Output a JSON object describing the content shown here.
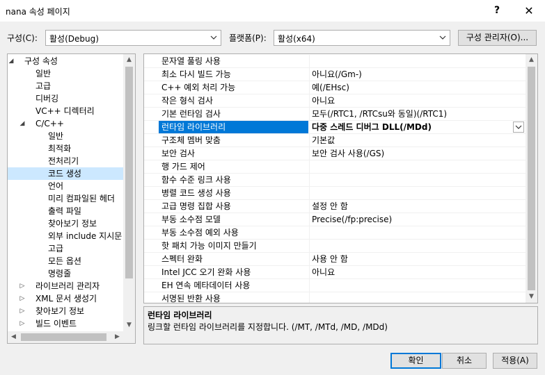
{
  "window": {
    "title": "nana 속성 페이지",
    "help": "?",
    "close": "✕"
  },
  "config": {
    "label": "구성(C):",
    "value": "활성(Debug)"
  },
  "platform": {
    "label": "플랫폼(P):",
    "value": "활성(x64)"
  },
  "config_manager_label": "구성 관리자(O)...",
  "tree": [
    {
      "label": "구성 속성",
      "level": 0,
      "expander": "◢"
    },
    {
      "label": "일반",
      "level": 1
    },
    {
      "label": "고급",
      "level": 1
    },
    {
      "label": "디버깅",
      "level": 1
    },
    {
      "label": "VC++ 디렉터리",
      "level": 1
    },
    {
      "label": "C/C++",
      "level": 1,
      "expander": "◢"
    },
    {
      "label": "일반",
      "level": 2
    },
    {
      "label": "최적화",
      "level": 2
    },
    {
      "label": "전처리기",
      "level": 2
    },
    {
      "label": "코드 생성",
      "level": 2,
      "selected": true
    },
    {
      "label": "언어",
      "level": 2
    },
    {
      "label": "미리 컴파일된 헤더",
      "level": 2
    },
    {
      "label": "출력 파일",
      "level": 2
    },
    {
      "label": "찾아보기 정보",
      "level": 2
    },
    {
      "label": "외부 include 지시문",
      "level": 2
    },
    {
      "label": "고급",
      "level": 2
    },
    {
      "label": "모든 옵션",
      "level": 2
    },
    {
      "label": "명령줄",
      "level": 2
    },
    {
      "label": "라이브러리 관리자",
      "level": 1,
      "expander": "▷"
    },
    {
      "label": "XML 문서 생성기",
      "level": 1,
      "expander": "▷"
    },
    {
      "label": "찾아보기 정보",
      "level": 1,
      "expander": "▷"
    },
    {
      "label": "빌드 이벤트",
      "level": 1,
      "expander": "▷"
    }
  ],
  "properties": [
    {
      "name": "문자열 풀링 사용",
      "value": ""
    },
    {
      "name": "최소 다시 빌드 가능",
      "value": "아니요(/Gm-)"
    },
    {
      "name": "C++ 예외 처리 가능",
      "value": "예(/EHsc)"
    },
    {
      "name": "작은 형식 검사",
      "value": "아니요"
    },
    {
      "name": "기본 런타임 검사",
      "value": "모두(/RTC1, /RTCsu와 동일)(/RTC1)"
    },
    {
      "name": "런타임 라이브러리",
      "value": "다중 스레드 디버그 DLL(/MDd)",
      "selected": true
    },
    {
      "name": "구조체 멤버 맞춤",
      "value": "기본값"
    },
    {
      "name": "보안 검사",
      "value": "보안 검사 사용(/GS)"
    },
    {
      "name": "행 가드 제어",
      "value": ""
    },
    {
      "name": "함수 수준 링크 사용",
      "value": ""
    },
    {
      "name": "병렬 코드 생성 사용",
      "value": ""
    },
    {
      "name": "고급 명령 집합 사용",
      "value": "설정 안 함"
    },
    {
      "name": "부동 소수점 모델",
      "value": "Precise(/fp:precise)"
    },
    {
      "name": "부동 소수점 예외 사용",
      "value": ""
    },
    {
      "name": "핫 패치 가능 이미지 만들기",
      "value": ""
    },
    {
      "name": "스펙터 완화",
      "value": "사용 안 함"
    },
    {
      "name": "Intel JCC 오기 완화 사용",
      "value": "아니요"
    },
    {
      "name": "EH 연속 메타데이터 사용",
      "value": ""
    },
    {
      "name": "서명된 반환 사용",
      "value": ""
    }
  ],
  "description": {
    "title": "런타임 라이브러리",
    "text": "링크할 런타임 라이브러리를 지정합니다.     (/MT, /MTd, /MD, /MDd)"
  },
  "buttons": {
    "ok": "확인",
    "cancel": "취소",
    "apply": "적용(A)"
  },
  "icons": {
    "dropdown": "chevron-down-icon",
    "scroll_up": "▲",
    "scroll_down": "▼",
    "scroll_left": "◀",
    "scroll_right": "▶"
  },
  "colors": {
    "selection": "#0078d7",
    "tree_selection": "#cce8ff"
  }
}
